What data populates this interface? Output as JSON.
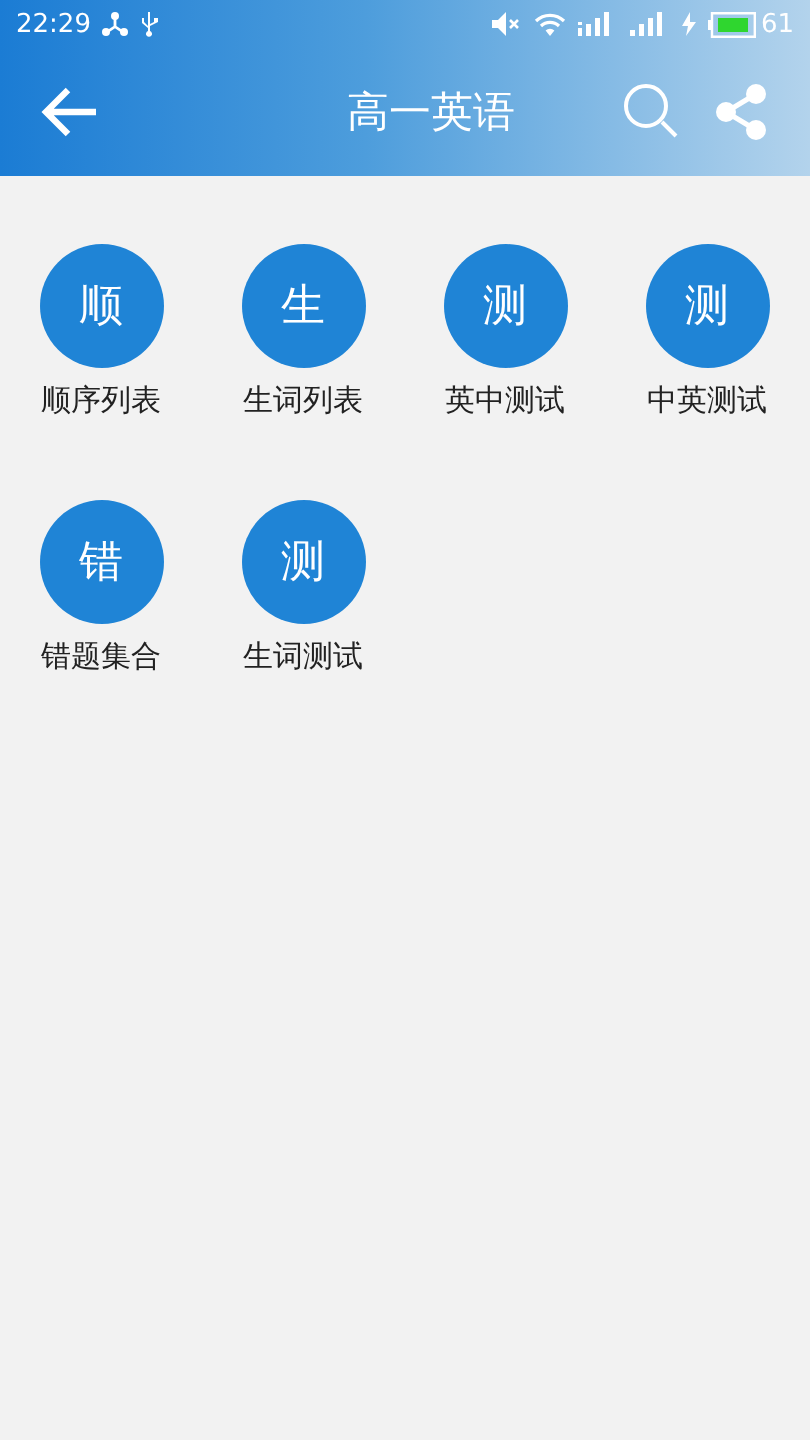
{
  "status_bar": {
    "time": "22:29",
    "battery": "61"
  },
  "header": {
    "title": "高一英语"
  },
  "menu": [
    {
      "glyph": "顺",
      "label": "顺序列表"
    },
    {
      "glyph": "生",
      "label": "生词列表"
    },
    {
      "glyph": "测",
      "label": "英中测试"
    },
    {
      "glyph": "测",
      "label": "中英测试"
    },
    {
      "glyph": "错",
      "label": "错题集合"
    },
    {
      "glyph": "测",
      "label": "生词测试"
    }
  ]
}
